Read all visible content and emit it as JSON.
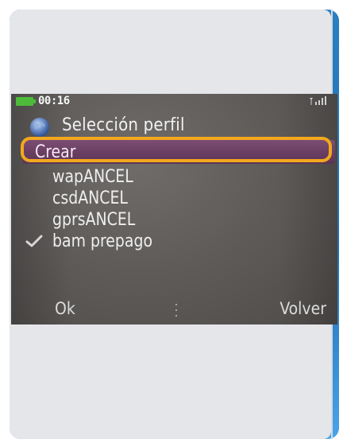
{
  "status_bar": {
    "time": "00:16",
    "battery_icon": "battery-icon",
    "signal_icon": "signal-icon",
    "battery_color": "#4dbb3a"
  },
  "header": {
    "title": "Selección perfil",
    "icon": "globe-icon"
  },
  "menu": {
    "items": [
      {
        "label": "Crear",
        "selected": true,
        "checked": false
      },
      {
        "label": "wapANCEL",
        "selected": false,
        "checked": false
      },
      {
        "label": "csdANCEL",
        "selected": false,
        "checked": false
      },
      {
        "label": "gprsANCEL",
        "selected": false,
        "checked": false
      },
      {
        "label": "bam prepago",
        "selected": false,
        "checked": true
      }
    ],
    "highlight_color": "#f2a81d",
    "selection_color": "#6b3f64"
  },
  "softkeys": {
    "left": "Ok",
    "right": "Volver"
  },
  "colors": {
    "card_background": "#e4e6e9",
    "card_edge": "#1f6fb4",
    "screen_background": "#5f5c5a"
  }
}
